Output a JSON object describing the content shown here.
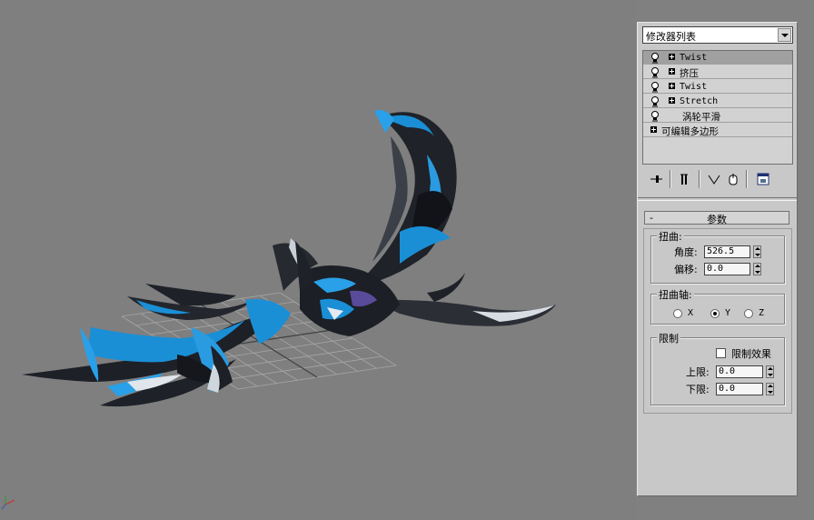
{
  "modifier_list": {
    "label": "修改器列表"
  },
  "stack": [
    {
      "label": "Twist",
      "has_bulb": true,
      "has_plus": true,
      "selected": true,
      "mono": true
    },
    {
      "label": "挤压",
      "has_bulb": true,
      "has_plus": true,
      "selected": false,
      "mono": false
    },
    {
      "label": "Twist",
      "has_bulb": true,
      "has_plus": true,
      "selected": false,
      "mono": true
    },
    {
      "label": "Stretch",
      "has_bulb": true,
      "has_plus": true,
      "selected": false,
      "mono": true
    },
    {
      "label": "涡轮平滑",
      "has_bulb": true,
      "has_plus": false,
      "selected": false,
      "mono": false
    },
    {
      "label": "可编辑多边形",
      "has_bulb": false,
      "has_plus": true,
      "selected": false,
      "mono": false
    }
  ],
  "stack_tools": [
    "pin-stack-icon",
    "show-end-result-icon",
    "make-unique-icon",
    "remove-modifier-icon",
    "configure-modifier-sets-icon"
  ],
  "params": {
    "rollout_toggle": "-",
    "rollout_title": "参数",
    "twist_group": "扭曲:",
    "angle_label": "角度:",
    "angle_value": "526.5",
    "bias_label": "偏移:",
    "bias_value": "0.0",
    "axis_group": "扭曲轴:",
    "axis_x": "X",
    "axis_y": "Y",
    "axis_z": "Z",
    "axis_selected": "Y",
    "limit_group": "限制",
    "limit_effect_label": "限制效果",
    "limit_effect_checked": false,
    "upper_label": "上限:",
    "upper_value": "0.0",
    "lower_label": "下限:",
    "lower_value": "0.0"
  },
  "colors": {
    "viewport_bg": "#7f7f7f",
    "panel_bg": "#c8c8c8",
    "model_blue": "#1a8fd6",
    "model_dark": "#1e2128",
    "grid": "#a8a8a8"
  }
}
